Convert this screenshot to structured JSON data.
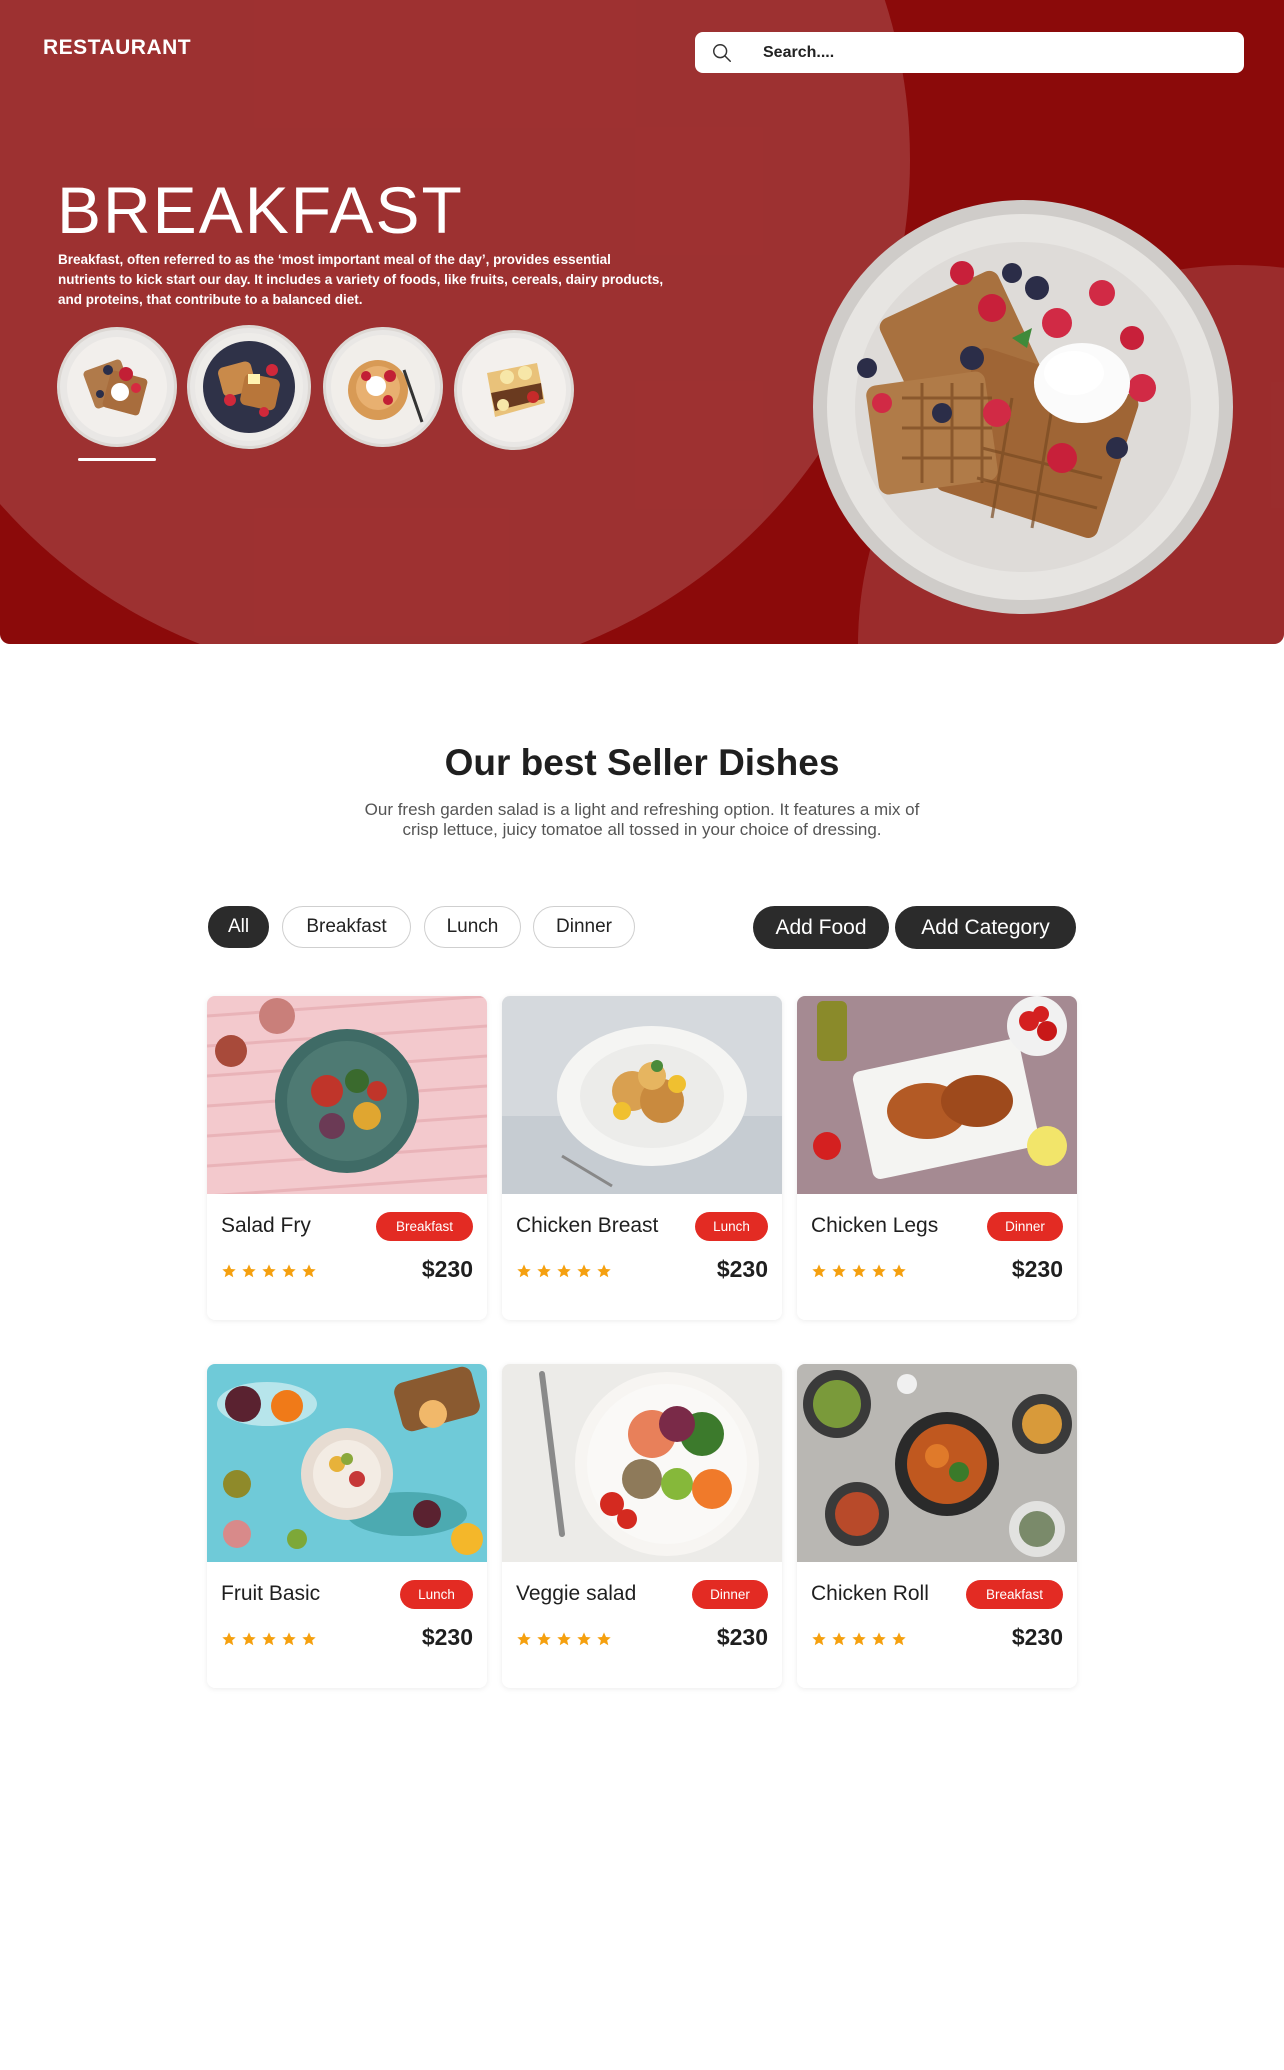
{
  "header": {
    "brand": "RESTAURANT",
    "search_placeholder": "Search...."
  },
  "hero": {
    "title": "BREAKFAST",
    "description": "Breakfast, often referred to as the ‘most important meal of the day’, provides essential nutrients to kick start our day. It includes a variety of foods, like fruits, cereals, dairy products, and proteins, that contribute to a balanced diet.",
    "thumbnails": [
      "waffles-berries",
      "french-toast",
      "pancakes-berries",
      "crepes-bananas"
    ],
    "selected_thumbnail": 0
  },
  "section": {
    "title": "Our best Seller Dishes",
    "description": "Our fresh garden salad is a light and refreshing option. It features a mix of crisp lettuce, juicy tomatoe all tossed in your choice of dressing."
  },
  "filters": [
    {
      "label": "All",
      "active": true
    },
    {
      "label": "Breakfast",
      "active": false
    },
    {
      "label": "Lunch",
      "active": false
    },
    {
      "label": "Dinner",
      "active": false
    }
  ],
  "actions": {
    "add_food": "Add Food",
    "add_category": "Add Category"
  },
  "dishes": [
    {
      "name": "Salad Fry",
      "category": "Breakfast",
      "price": "$230",
      "rating": 5
    },
    {
      "name": "Chicken Breast",
      "category": "Lunch",
      "price": "$230",
      "rating": 5
    },
    {
      "name": "Chicken Legs",
      "category": "Dinner",
      "price": "$230",
      "rating": 5
    },
    {
      "name": "Fruit Basic",
      "category": "Lunch",
      "price": "$230",
      "rating": 5
    },
    {
      "name": "Veggie salad",
      "category": "Dinner",
      "price": "$230",
      "rating": 5
    },
    {
      "name": "Chicken Roll",
      "category": "Breakfast",
      "price": "$230",
      "rating": 5
    }
  ],
  "colors": {
    "hero_bg": "#8b0a0a",
    "badge": "#e32b23",
    "star": "#f5a00f",
    "dark_button": "#2b2b2b"
  }
}
